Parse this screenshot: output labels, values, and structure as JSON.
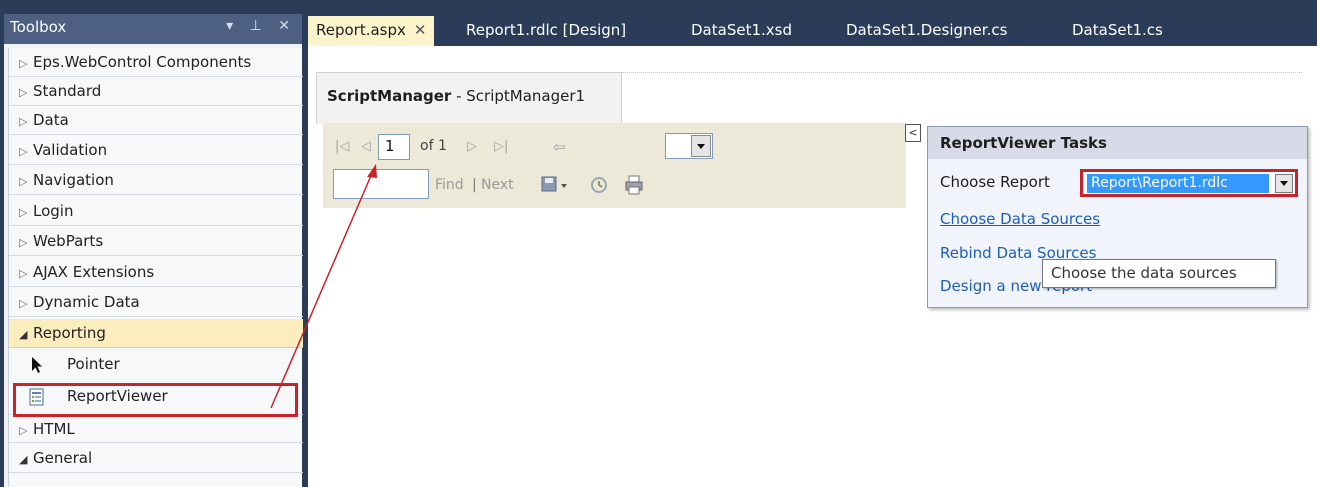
{
  "toolbox": {
    "title": "Toolbox",
    "title_icons": "▾ ⊥ ✕",
    "items": [
      {
        "label": "Eps.WebControl Components",
        "expanded": false
      },
      {
        "label": "Standard",
        "expanded": false
      },
      {
        "label": "Data",
        "expanded": false
      },
      {
        "label": "Validation",
        "expanded": false
      },
      {
        "label": "Navigation",
        "expanded": false
      },
      {
        "label": "Login",
        "expanded": false
      },
      {
        "label": "WebParts",
        "expanded": false
      },
      {
        "label": "AJAX Extensions",
        "expanded": false
      },
      {
        "label": "Dynamic Data",
        "expanded": false
      },
      {
        "label": "Reporting",
        "expanded": true
      },
      {
        "label": "HTML",
        "expanded": false
      },
      {
        "label": "General",
        "expanded": true
      }
    ],
    "reporting_children": [
      {
        "label": "Pointer",
        "icon": "pointer-icon"
      },
      {
        "label": "ReportViewer",
        "icon": "report-viewer-icon"
      }
    ]
  },
  "tabs": [
    {
      "label": "Report.aspx",
      "active": true
    },
    {
      "label": "Report1.rdlc [Design]",
      "active": false
    },
    {
      "label": "DataSet1.xsd",
      "active": false
    },
    {
      "label": "DataSet1.Designer.cs",
      "active": false
    },
    {
      "label": "DataSet1.cs",
      "active": false
    }
  ],
  "script_manager": {
    "type": "ScriptManager",
    "separator": " - ",
    "id": "ScriptManager1"
  },
  "viewer": {
    "page_value": "1",
    "page_of": "of 1",
    "find_label": "Find",
    "find_separator": "|",
    "next_label": "Next"
  },
  "tasks": {
    "header": "ReportViewer Tasks",
    "choose_report_label": "Choose Report",
    "choose_report_value": "Report\\Report1.rdlc",
    "choose_data_sources": "Choose Data Sources",
    "rebind_data_sources": "Rebind Data Sources",
    "design_new_report": "Design a new report",
    "tooltip": "Choose the data sources"
  },
  "colors": {
    "highlight": "#c8222a",
    "link": "#1d5fb4",
    "title_bar": "#4d6082",
    "active_tab": "#fdf4cc"
  }
}
